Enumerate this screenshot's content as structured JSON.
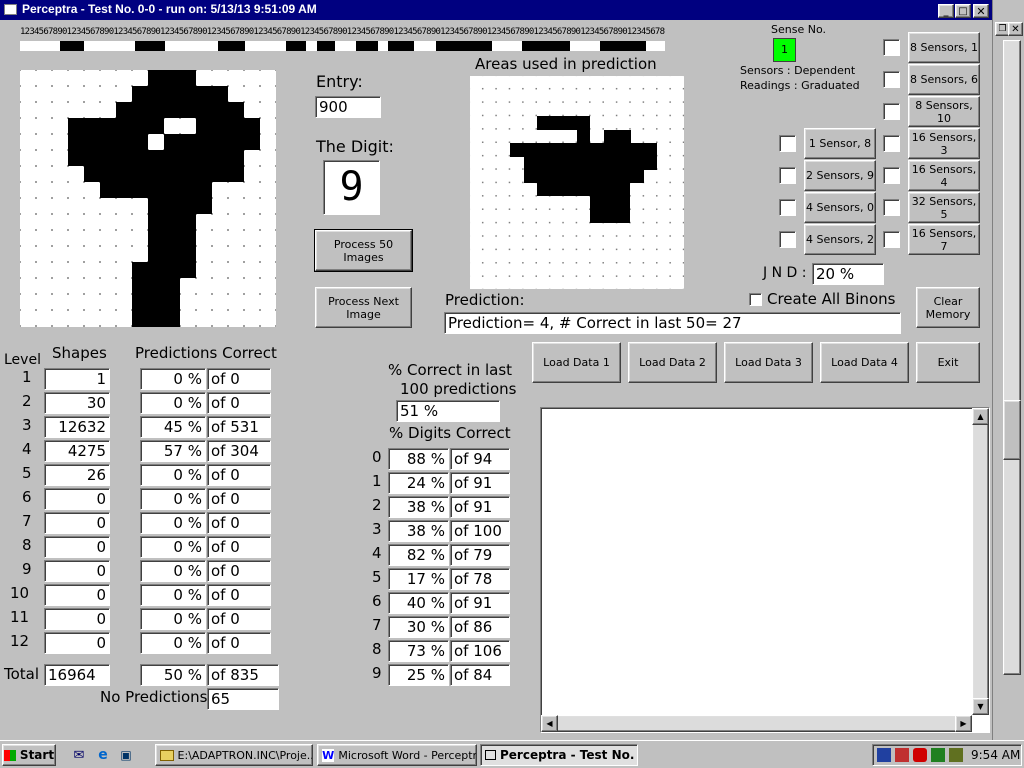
{
  "window": {
    "title": "Perceptra - Test No. 0-0 - run on: 5/13/13  9:51:09 AM"
  },
  "ruler": {
    "digits": "12345678901234567890123456789012345678901234567890123456789012345678901234567890123456789012345678901234567890123456789012345678901234567890123456789012345678901234567890123456789012345678901234567890123456789012345678901234567890123456789012345678901234567890123456789012345678"
  },
  "entry": {
    "label": "Entry:",
    "value": "900"
  },
  "digit": {
    "label": "The Digit:",
    "value": "9"
  },
  "areas": {
    "label": "Areas used in prediction"
  },
  "buttons": {
    "process50": "Process 50 Images",
    "processNext": "Process Next Image",
    "clearMemory": "Clear Memory",
    "load1": "Load Data 1",
    "load2": "Load Data 2",
    "load3": "Load Data 3",
    "load4": "Load Data 4",
    "exit": "Exit"
  },
  "sense": {
    "label": "Sense No.",
    "value": "1",
    "sensors": "Sensors  :  Dependent",
    "readings": "Readings : Graduated"
  },
  "sensorButtonsRight": [
    "8 Sensors, 1",
    "8 Sensors, 6",
    "8 Sensors, 10",
    "16 Sensors, 3",
    "16 Sensors, 4",
    "32 Sensors, 5",
    "16 Sensors, 7"
  ],
  "sensorButtonsLeft": [
    "1 Sensor, 8",
    "2 Sensors, 9",
    "4 Sensors, 0",
    "4 Sensors, 2"
  ],
  "jnd": {
    "label": "J N D :",
    "value": "20 %"
  },
  "createAll": {
    "label": "Create All Binons"
  },
  "prediction": {
    "label": "Prediction:",
    "value": "Prediction= 4, # Correct in last 50= 27"
  },
  "levels": {
    "levelHeader": "Level",
    "shapesHeader": "Shapes",
    "predHeader": "Predictions Correct",
    "rows": [
      {
        "level": "1",
        "shapes": "1",
        "pct": "0 %",
        "of": "of 0"
      },
      {
        "level": "2",
        "shapes": "30",
        "pct": "0 %",
        "of": "of 0"
      },
      {
        "level": "3",
        "shapes": "12632",
        "pct": "45 %",
        "of": "of 531"
      },
      {
        "level": "4",
        "shapes": "4275",
        "pct": "57 %",
        "of": "of 304"
      },
      {
        "level": "5",
        "shapes": "26",
        "pct": "0 %",
        "of": "of 0"
      },
      {
        "level": "6",
        "shapes": "0",
        "pct": "0 %",
        "of": "of 0"
      },
      {
        "level": "7",
        "shapes": "0",
        "pct": "0 %",
        "of": "of 0"
      },
      {
        "level": "8",
        "shapes": "0",
        "pct": "0 %",
        "of": "of 0"
      },
      {
        "level": "9",
        "shapes": "0",
        "pct": "0 %",
        "of": "of 0"
      },
      {
        "level": "10",
        "shapes": "0",
        "pct": "0 %",
        "of": "of 0"
      },
      {
        "level": "11",
        "shapes": "0",
        "pct": "0 %",
        "of": "of 0"
      },
      {
        "level": "12",
        "shapes": "0",
        "pct": "0 %",
        "of": "of 0"
      }
    ],
    "totalLabel": "Total",
    "totalShapes": "16964",
    "totalPct": "50 %",
    "totalOf": "of 835",
    "noPredLabel": "No Predictions:",
    "noPredValue": "65"
  },
  "last100": {
    "label1": "% Correct in last",
    "label2": "100 predictions",
    "value": "51 %"
  },
  "digitsCorrect": {
    "label": "% Digits Correct",
    "rows": [
      {
        "digit": "0",
        "pct": "88 %",
        "of": "of 94"
      },
      {
        "digit": "1",
        "pct": "24 %",
        "of": "of 91"
      },
      {
        "digit": "2",
        "pct": "38 %",
        "of": "of 91"
      },
      {
        "digit": "3",
        "pct": "38 %",
        "of": "of 100"
      },
      {
        "digit": "4",
        "pct": "82 %",
        "of": "of 79"
      },
      {
        "digit": "5",
        "pct": "17 %",
        "of": "of 78"
      },
      {
        "digit": "6",
        "pct": "40 %",
        "of": "of 91"
      },
      {
        "digit": "7",
        "pct": "30 %",
        "of": "of 86"
      },
      {
        "digit": "8",
        "pct": "73 %",
        "of": "of 106"
      },
      {
        "digit": "9",
        "pct": "25 %",
        "of": "of 84"
      }
    ]
  },
  "taskbar": {
    "start": "Start",
    "tasks": [
      "E:\\ADAPTRON.INC\\Proje...",
      "Microsoft Word - Perceptra...",
      "Perceptra - Test No. ..."
    ],
    "clock": "9:54 AM"
  },
  "colors": {
    "titlebar": "#000080",
    "senseIndicator": "#00ff00",
    "face": "#c0c0c0"
  }
}
